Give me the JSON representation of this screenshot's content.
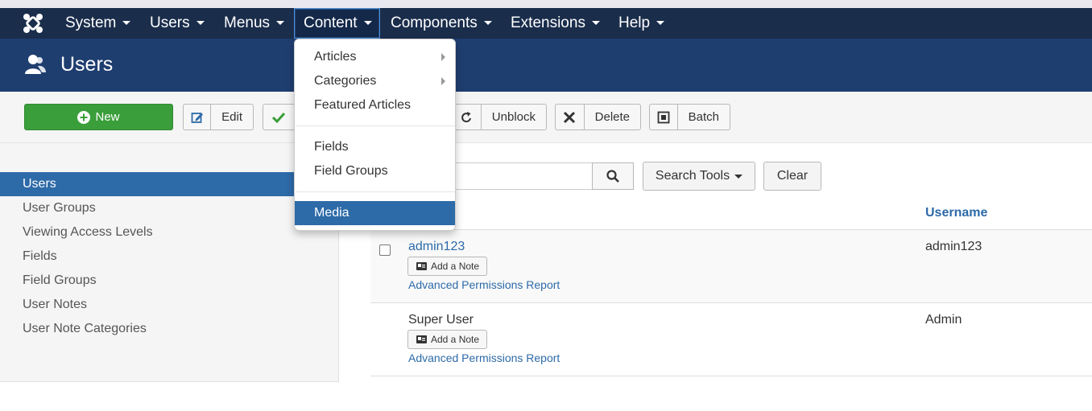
{
  "nav": {
    "items": [
      {
        "label": "System"
      },
      {
        "label": "Users"
      },
      {
        "label": "Menus"
      },
      {
        "label": "Content"
      },
      {
        "label": "Components"
      },
      {
        "label": "Extensions"
      },
      {
        "label": "Help"
      }
    ]
  },
  "header": {
    "title": "Users"
  },
  "toolbar": {
    "new_label": "New",
    "edit_label": "Edit",
    "unblock_label": "Unblock",
    "delete_label": "Delete",
    "batch_label": "Batch"
  },
  "sidebar": {
    "items": [
      {
        "label": "Users"
      },
      {
        "label": "User Groups"
      },
      {
        "label": "Viewing Access Levels"
      },
      {
        "label": "Fields"
      },
      {
        "label": "Field Groups"
      },
      {
        "label": "User Notes"
      },
      {
        "label": "User Note Categories"
      }
    ]
  },
  "search": {
    "placeholder": "",
    "search_tools_label": "Search Tools",
    "clear_label": "Clear"
  },
  "table": {
    "columns": {
      "username": "Username"
    },
    "rows": [
      {
        "name": "admin123",
        "note_label": "Add a Note",
        "permissions_label": "Advanced Permissions Report",
        "username": "admin123"
      },
      {
        "name": "Super User",
        "note_label": "Add a Note",
        "permissions_label": "Advanced Permissions Report",
        "username": "Admin"
      }
    ]
  },
  "content_menu": {
    "items": [
      {
        "label": "Articles"
      },
      {
        "label": "Categories"
      },
      {
        "label": "Featured Articles"
      },
      {
        "label": "Fields"
      },
      {
        "label": "Field Groups"
      },
      {
        "label": "Media"
      }
    ]
  },
  "colors": {
    "navbar": "#1a2d4b",
    "header": "#1f3e70",
    "accent": "#2d6aa8",
    "new_button": "#3a9e3a"
  }
}
